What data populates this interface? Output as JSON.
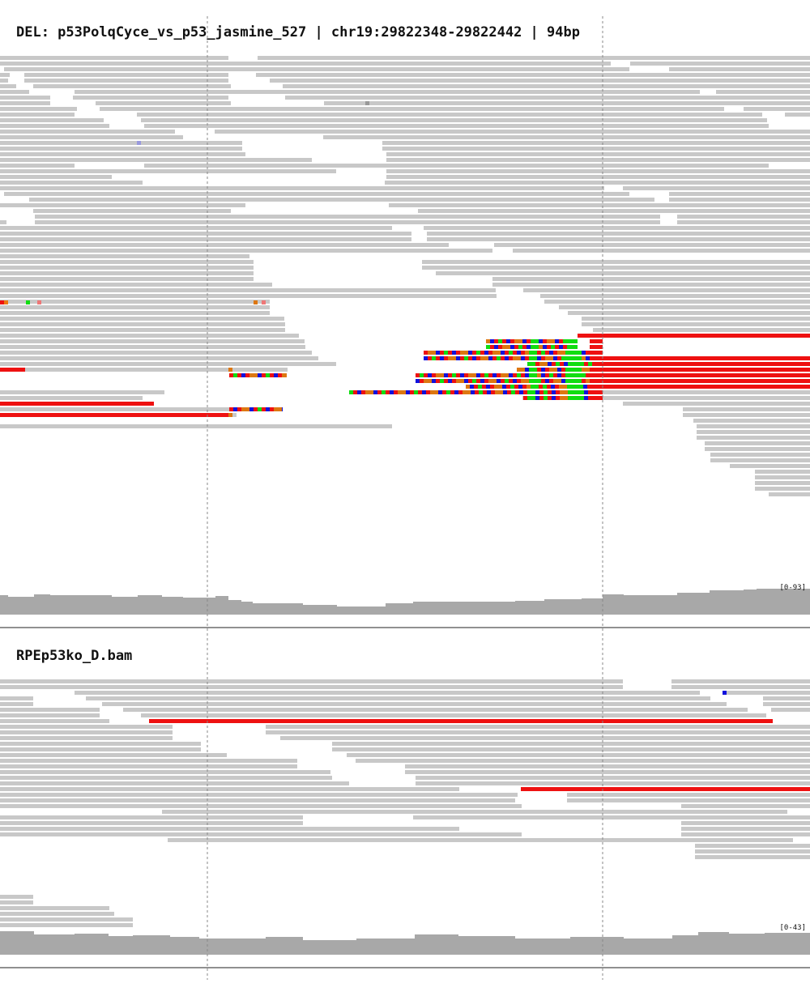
{
  "panels": [
    {
      "title": "DEL: p53PolqCyce_vs_p53_jasmine_527 | chr19:29822348-29822442 | 94bp",
      "coverage_scale": "[0-93]"
    },
    {
      "title": "RPEp53ko_D.bam",
      "coverage_scale": "[0-43]"
    }
  ],
  "colors": {
    "read": "#c8c8c8",
    "deletion_read": "#ee1111",
    "coverage": "#a8a8a8",
    "mismatch_A": "#11dd11",
    "mismatch_C": "#1111dd",
    "mismatch_G": "#dd7711",
    "mismatch_T": "#ee1111",
    "breakpoint_line": "#888888"
  }
}
